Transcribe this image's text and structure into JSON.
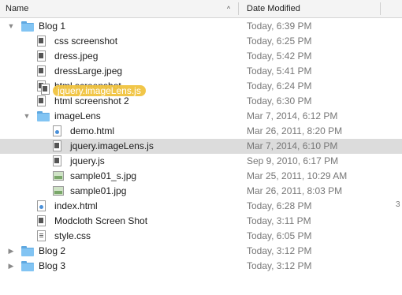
{
  "columns": {
    "name": "Name",
    "date_modified": "Date Modified"
  },
  "rows": [
    {
      "name": "Blog 1",
      "date": "Today, 6:39 PM",
      "depth": 0,
      "kind": "folder",
      "expanded": true
    },
    {
      "name": "css screenshot",
      "date": "Today, 6:25 PM",
      "depth": 1,
      "kind": "file-dark"
    },
    {
      "name": "dress.jpeg",
      "date": "Today, 5:42 PM",
      "depth": 1,
      "kind": "file-dark"
    },
    {
      "name": "dressLarge.jpeg",
      "date": "Today, 5:41 PM",
      "depth": 1,
      "kind": "file-dark"
    },
    {
      "name": "html screenshot",
      "date": "Today, 6:24 PM",
      "depth": 1,
      "kind": "file-dark"
    },
    {
      "name": "html screenshot 2",
      "date": "Today, 6:30 PM",
      "depth": 1,
      "kind": "file-dark"
    },
    {
      "name": "imageLens",
      "date": "Mar 7, 2014, 6:12 PM",
      "depth": 1,
      "kind": "folder",
      "expanded": true
    },
    {
      "name": "demo.html",
      "date": "Mar 26, 2011, 8:20 PM",
      "depth": 2,
      "kind": "html"
    },
    {
      "name": "jquery.imageLens.js",
      "date": "Mar 7, 2014, 6:10 PM",
      "depth": 2,
      "kind": "file-dark",
      "selected": true
    },
    {
      "name": "jquery.js",
      "date": "Sep 9, 2010, 6:17 PM",
      "depth": 2,
      "kind": "file-dark"
    },
    {
      "name": "sample01_s.jpg",
      "date": "Mar 25, 2011, 10:29 AM",
      "depth": 2,
      "kind": "image"
    },
    {
      "name": "sample01.jpg",
      "date": "Mar 26, 2011, 8:03 PM",
      "depth": 2,
      "kind": "image"
    },
    {
      "name": "index.html",
      "date": "Today, 6:28 PM",
      "depth": 1,
      "kind": "html"
    },
    {
      "name": "Modcloth Screen Shot",
      "date": "Today, 3:11 PM",
      "depth": 1,
      "kind": "file-dark"
    },
    {
      "name": "style.css",
      "date": "Today, 6:05 PM",
      "depth": 1,
      "kind": "file"
    },
    {
      "name": "Blog 2",
      "date": "Today, 3:12 PM",
      "depth": 0,
      "kind": "folder",
      "expanded": false
    },
    {
      "name": "Blog 3",
      "date": "Today, 3:12 PM",
      "depth": 0,
      "kind": "folder",
      "expanded": false
    }
  ],
  "drag_ghost": "jquery.imageLens.js",
  "truncated_column_glyph": "3",
  "icons": {
    "collapse": "triangle-down",
    "expand": "triangle-right",
    "sort": "chevron-up"
  }
}
